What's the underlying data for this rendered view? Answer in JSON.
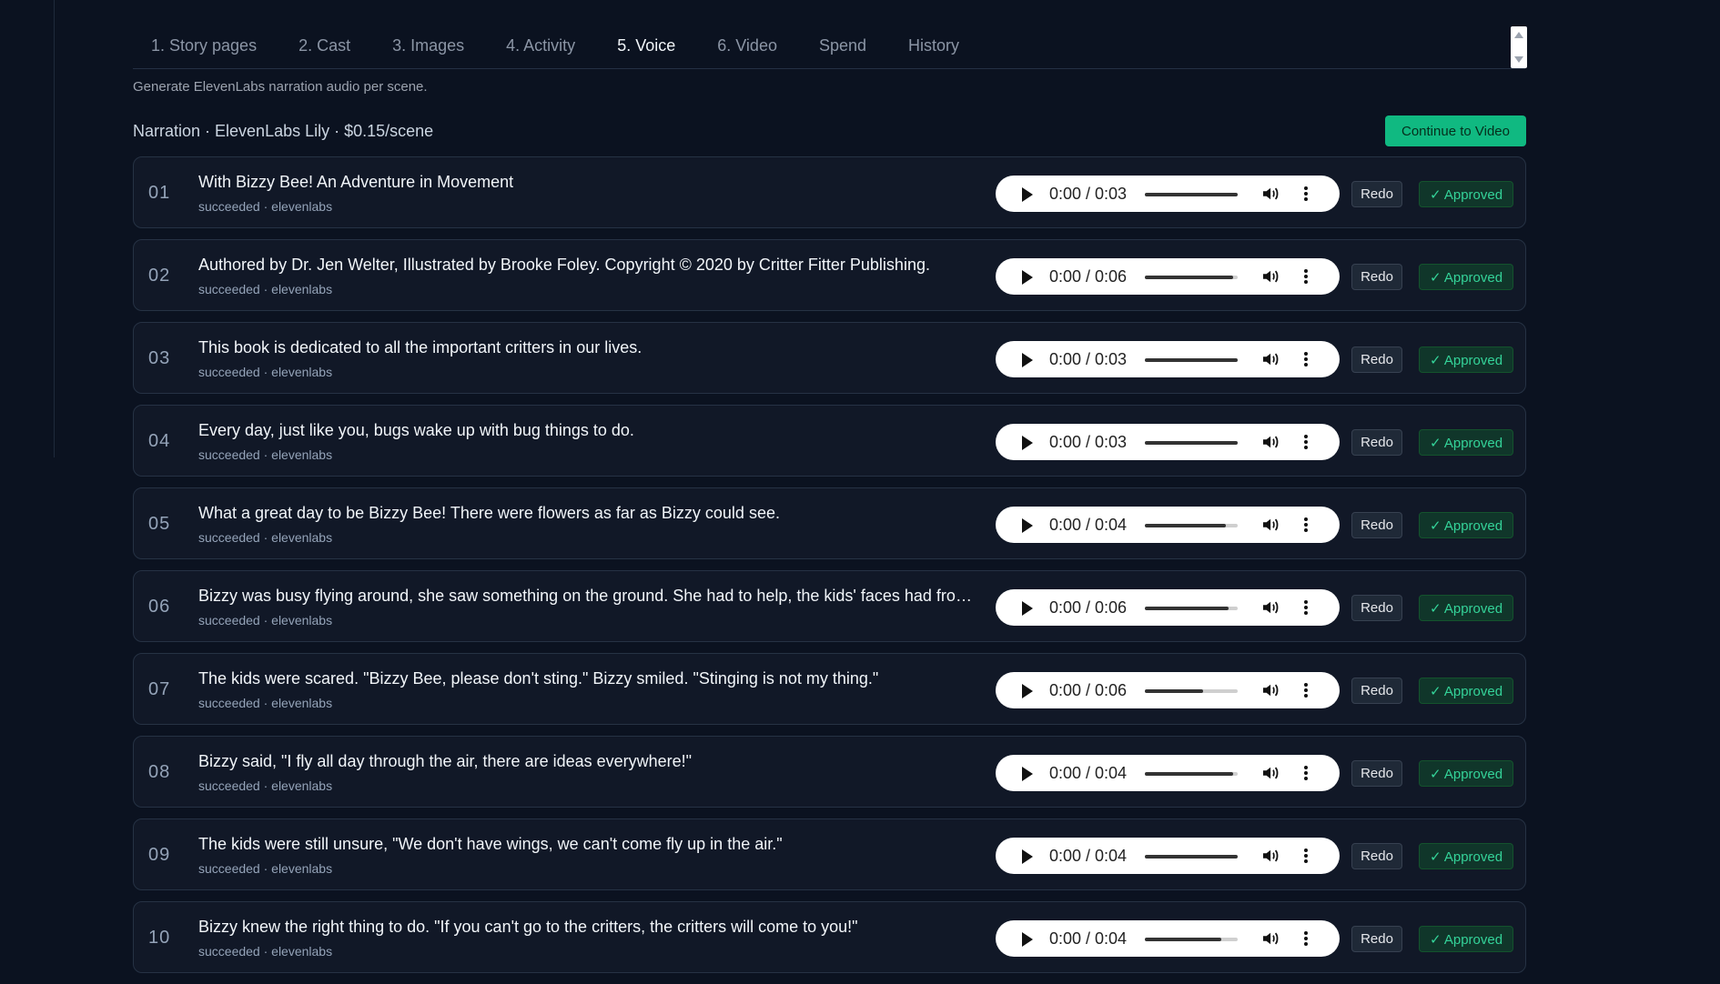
{
  "tabs": [
    {
      "label": "1. Story pages",
      "active": false
    },
    {
      "label": "2. Cast",
      "active": false
    },
    {
      "label": "3. Images",
      "active": false
    },
    {
      "label": "4. Activity",
      "active": false
    },
    {
      "label": "5. Voice",
      "active": true
    },
    {
      "label": "6. Video",
      "active": false
    },
    {
      "label": "Spend",
      "active": false
    },
    {
      "label": "History",
      "active": false
    }
  ],
  "subtitle": "Generate ElevenLabs narration audio per scene.",
  "section_title": "Narration · ElevenLabs Lily · $0.15/scene",
  "continue_label": "Continue to Video",
  "redo_label": "Redo",
  "approved_label": "✓ Approved",
  "colors": {
    "accent": "#10b981",
    "background": "#0b1220",
    "card": "#111827"
  },
  "rows": [
    {
      "num": "01",
      "text": "With Bizzy Bee! An Adventure in Movement",
      "meta": "succeeded · elevenlabs",
      "time": "0:00 / 0:03",
      "volume": 1.0
    },
    {
      "num": "02",
      "text": "Authored by Dr. Jen Welter, Illustrated by Brooke Foley. Copyright © 2020 by Critter Fitter Publishing.",
      "meta": "succeeded · elevenlabs",
      "time": "0:00 / 0:06",
      "volume": 0.95
    },
    {
      "num": "03",
      "text": "This book is dedicated to all the important critters in our lives.",
      "meta": "succeeded · elevenlabs",
      "time": "0:00 / 0:03",
      "volume": 1.0
    },
    {
      "num": "04",
      "text": "Every day, just like you, bugs wake up with bug things to do.",
      "meta": "succeeded · elevenlabs",
      "time": "0:00 / 0:03",
      "volume": 1.0
    },
    {
      "num": "05",
      "text": "What a great day to be Bizzy Bee! There were flowers as far as Bizzy could see.",
      "meta": "succeeded · elevenlabs",
      "time": "0:00 / 0:04",
      "volume": 0.87
    },
    {
      "num": "06",
      "text": "Bizzy was busy flying around, she saw something on the ground. She had to help, the kids' faces had frowns.",
      "meta": "succeeded · elevenlabs",
      "time": "0:00 / 0:06",
      "volume": 0.9
    },
    {
      "num": "07",
      "text": "The kids were scared. \"Bizzy Bee, please don't sting.\" Bizzy smiled. \"Stinging is not my thing.\"",
      "meta": "succeeded · elevenlabs",
      "time": "0:00 / 0:06",
      "volume": 0.63
    },
    {
      "num": "08",
      "text": "Bizzy said, \"I fly all day through the air, there are ideas everywhere!\"",
      "meta": "succeeded · elevenlabs",
      "time": "0:00 / 0:04",
      "volume": 0.95
    },
    {
      "num": "09",
      "text": "The kids were still unsure, \"We don't have wings, we can't come fly up in the air.\"",
      "meta": "succeeded · elevenlabs",
      "time": "0:00 / 0:04",
      "volume": 1.0
    },
    {
      "num": "10",
      "text": "Bizzy knew the right thing to do. \"If you can't go to the critters, the critters will come to you!\"",
      "meta": "succeeded · elevenlabs",
      "time": "0:00 / 0:04",
      "volume": 0.82
    }
  ]
}
